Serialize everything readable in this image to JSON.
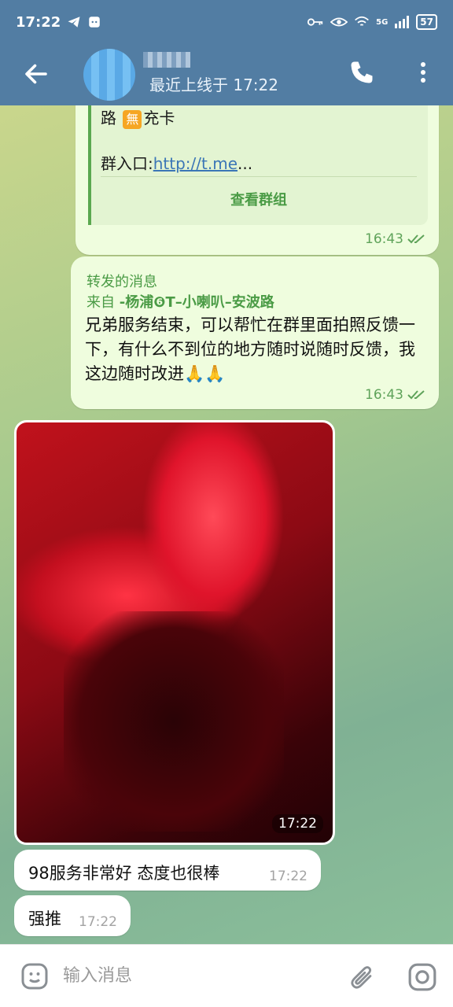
{
  "status_bar": {
    "time": "17:22",
    "network": "5G",
    "battery": "57"
  },
  "header": {
    "last_seen": "最近上线于 17:22"
  },
  "messages": {
    "card": {
      "line1_prefix": "路",
      "badge": "無",
      "line1_suffix": "充卡",
      "line2_label": "群入口:",
      "line2_link": "http://t.me",
      "line2_ellipsis": "...",
      "view_group": "查看群组",
      "time": "16:43"
    },
    "forwarded": {
      "label": "转发的消息",
      "from_prefix": "来自 ",
      "from_name": "-杨浦❻T–小喇叭–安波路",
      "text": "兄弟服务结束，可以帮忙在群里面拍照反馈一下，有什么不到位的地方随时说随时反馈，我这边随时改进🙏🙏",
      "time": "16:43"
    },
    "photo": {
      "time": "17:22"
    },
    "in1": {
      "text": "98服务非常好 态度也很棒",
      "time": "17:22"
    },
    "in2": {
      "text": "强推",
      "time": "17:22"
    }
  },
  "input": {
    "placeholder": "输入消息"
  },
  "icons": {
    "back": "arrow-left-icon",
    "call": "phone-icon",
    "more": "more-vertical-icon",
    "emoji": "emoji-icon",
    "attach": "paperclip-icon",
    "camera": "camera-icon",
    "read": "double-check-icon"
  },
  "colors": {
    "header": "#527da3",
    "outgoing_bubble": "#effdde",
    "incoming_bubble": "#ffffff",
    "accent_green": "#4a9b45",
    "link": "#3b76b6"
  }
}
